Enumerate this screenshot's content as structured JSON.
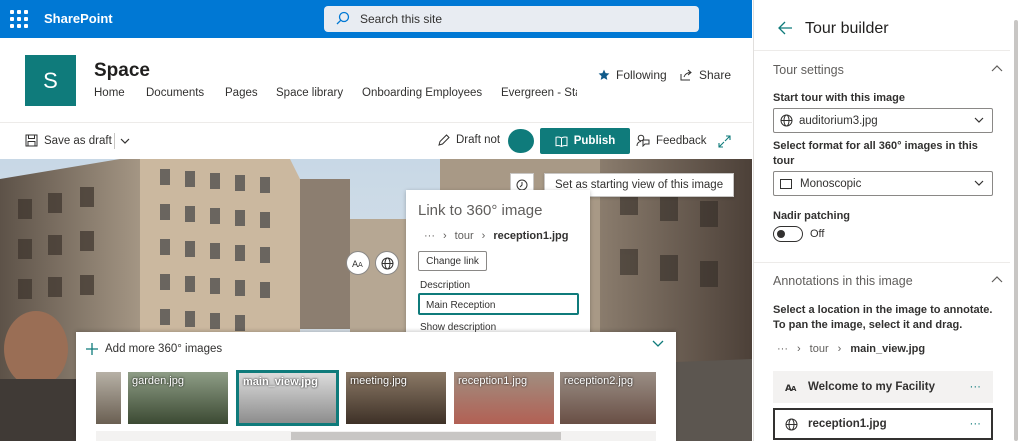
{
  "suite_bar": {
    "brand": "SharePoint",
    "search_placeholder": "Search this site"
  },
  "site": {
    "logo_letter": "S",
    "title": "Space",
    "nav": [
      "Home",
      "Documents",
      "Pages",
      "Space library",
      "Onboarding Employees",
      "Evergreen - Sta"
    ],
    "following_label": "Following",
    "share_label": "Share"
  },
  "command_bar": {
    "save_draft": "Save as draft",
    "draft_status": "Draft not",
    "publish": "Publish",
    "feedback": "Feedback"
  },
  "viewer": {
    "tooltip": "Set as starting view of this image",
    "link_card": {
      "title": "Link to 360° image",
      "breadcrumb_more": "···",
      "breadcrumb_folder": "tour",
      "breadcrumb_file": "reception1.jpg",
      "change_link": "Change link",
      "description_label": "Description",
      "description_value": "Main Reception",
      "show_description": "Show description"
    },
    "tray": {
      "add_more": "Add more 360° images",
      "thumbs": [
        "garden.jpg",
        "main_view.jpg",
        "meeting.jpg",
        "reception1.jpg",
        "reception2.jpg"
      ]
    }
  },
  "panel": {
    "title": "Tour builder",
    "tour_settings": "Tour settings",
    "start_label": "Start tour with this image",
    "start_value": "auditorium3.jpg",
    "format_label": "Select format for all 360° images in this tour",
    "format_value": "Monoscopic",
    "nadir_label": "Nadir patching",
    "nadir_state": "Off",
    "annotations_heading": "Annotations in this image",
    "annotations_help": "Select a location in the image to annotate. To pan the image, select it and drag.",
    "breadcrumb_more": "···",
    "breadcrumb_folder": "tour",
    "breadcrumb_file": "main_view.jpg",
    "annotations": [
      {
        "label": "Welcome to my Facility",
        "more": "···"
      },
      {
        "label": "reception1.jpg",
        "more": "···"
      }
    ]
  },
  "colors": {
    "suite": "#0078d4",
    "accent": "#0f7b7b"
  }
}
